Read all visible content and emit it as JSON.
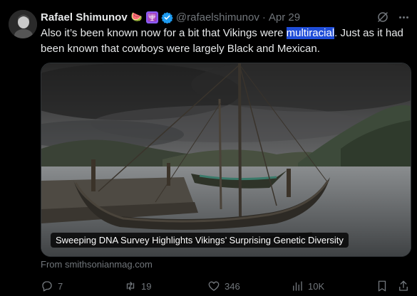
{
  "author": {
    "name": "Rafael Shimunov",
    "emoji": "🍉",
    "badge_glyph": "🕎",
    "handle": "@rafaelshimunov",
    "separator": "·",
    "date": "Apr 29"
  },
  "tweet": {
    "text_before": "Also it’s been known now for a bit that Vikings were ",
    "text_highlight": "multiracial",
    "text_after": ". Just as it had been known that cowboys were largely Black and Mexican."
  },
  "link_card": {
    "title": "Sweeping DNA Survey Highlights Vikings’ Surprising Genetic Diversity",
    "source": "From smithsonianmag.com"
  },
  "actions": {
    "replies": "7",
    "reposts": "19",
    "likes": "346",
    "views": "10K"
  },
  "colors": {
    "background": "#000000",
    "text": "#e7e9ea",
    "muted": "#71767b",
    "verified": "#1d9bf0",
    "highlight": "#1f4dd8"
  }
}
